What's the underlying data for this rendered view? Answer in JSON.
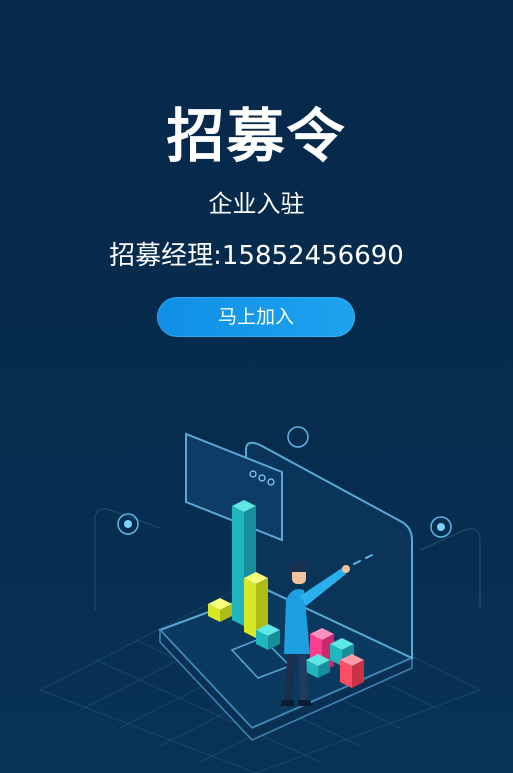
{
  "header": {
    "title": "招募令",
    "subtitle": "企业入驻",
    "contact": "招募经理:15852456690"
  },
  "actions": {
    "join_label": "马上加入"
  },
  "colors": {
    "background": "#062a4a",
    "button": "#1a9cee",
    "accent_teal": "#22c3c8",
    "accent_yellow": "#e8f03a",
    "accent_pink": "#ff3d8d"
  },
  "illustration": {
    "icon": "data-analytics-illustration"
  }
}
